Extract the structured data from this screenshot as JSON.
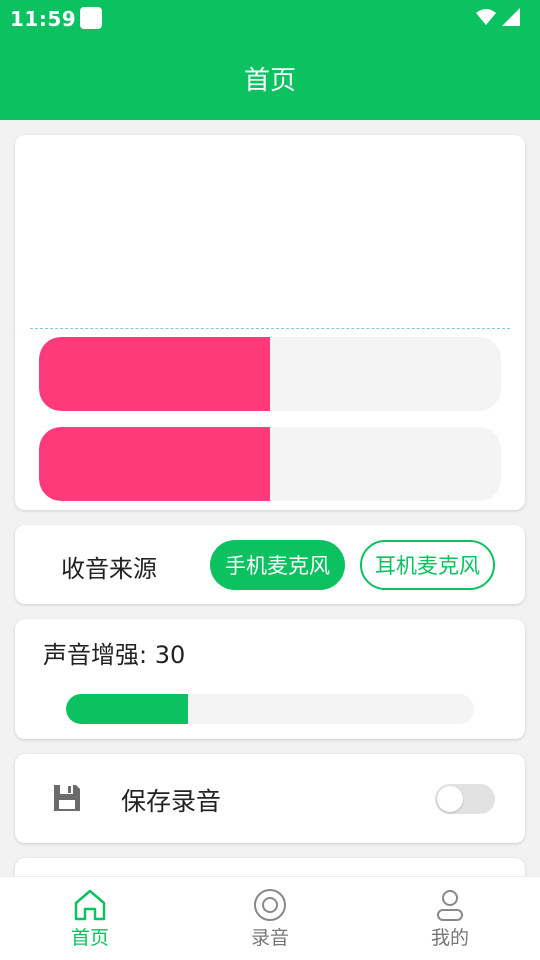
{
  "status_bar": {
    "time": "11:59",
    "icons": [
      "notification-square-icon",
      "wifi-icon",
      "signal-icon"
    ]
  },
  "app_bar": {
    "title": "首页"
  },
  "meter": {
    "bars": [
      {
        "level": 0.5
      },
      {
        "level": 0.5
      }
    ],
    "colors": {
      "fill": "#fe3a7a",
      "track": "#f4f4f4",
      "baseline": "#7ec8e3"
    }
  },
  "source": {
    "label": "收音来源",
    "options": [
      {
        "label": "手机麦克风",
        "selected": true
      },
      {
        "label": "耳机麦克风",
        "selected": false
      }
    ]
  },
  "boost": {
    "label": "声音增强: 30",
    "value": 30,
    "fraction": 0.3
  },
  "save": {
    "icon": "floppy-disk-icon",
    "label": "保存录音",
    "enabled": false
  },
  "bottom_nav": {
    "items": [
      {
        "label": "首页",
        "icon": "home-icon",
        "active": true
      },
      {
        "label": "录音",
        "icon": "record-disc-icon",
        "active": false
      },
      {
        "label": "我的",
        "icon": "person-icon",
        "active": false
      }
    ]
  },
  "colors": {
    "accent": "#0bc160",
    "meter": "#fe3a7a",
    "inactive": "#777777"
  }
}
